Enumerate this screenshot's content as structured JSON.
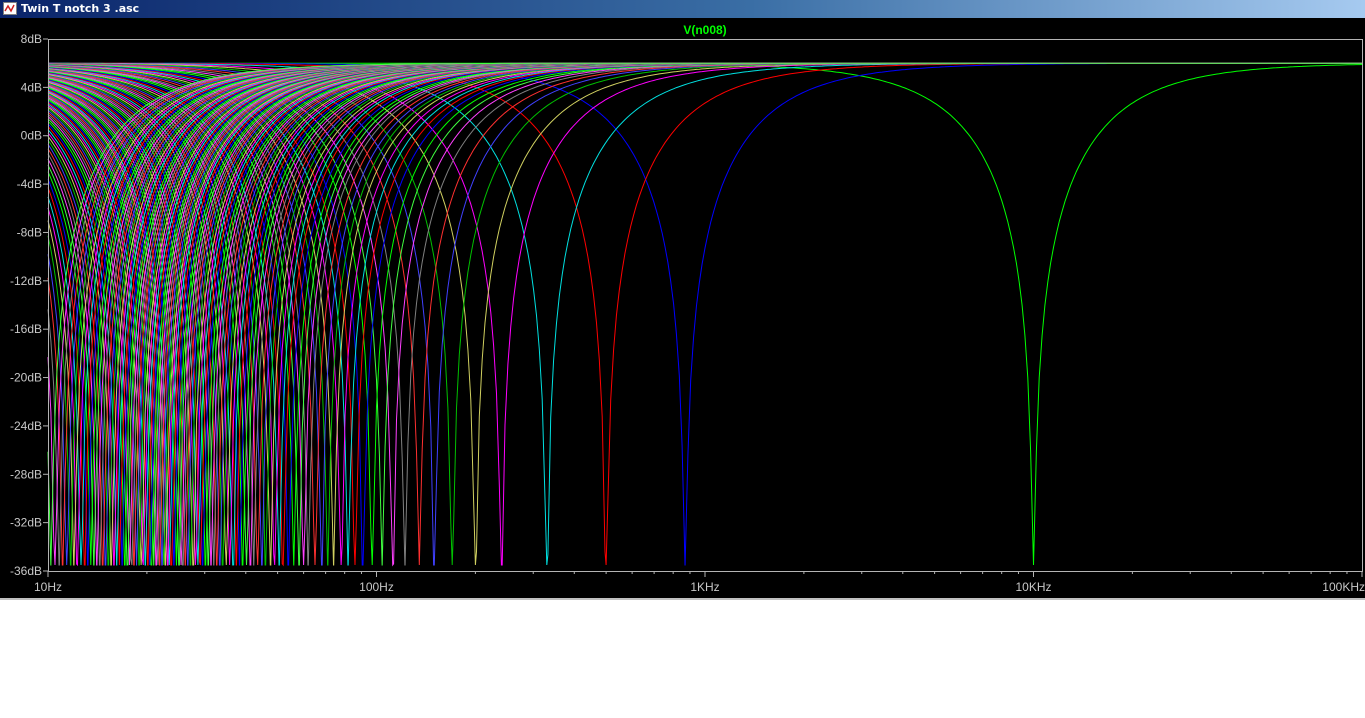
{
  "window": {
    "title": "Twin T notch 3 .asc"
  },
  "chart_data": {
    "type": "line",
    "title": "V(n008)",
    "xlabel": "",
    "ylabel": "",
    "x_scale": "log",
    "xlim": [
      10,
      100000
    ],
    "ylim": [
      -36,
      8
    ],
    "grid": false,
    "y_ticks": [
      "8dB",
      "4dB",
      "0dB",
      "-4dB",
      "-8dB",
      "-12dB",
      "-16dB",
      "-20dB",
      "-24dB",
      "-28dB",
      "-32dB",
      "-36dB"
    ],
    "y_tick_values": [
      8,
      4,
      0,
      -4,
      -8,
      -12,
      -16,
      -20,
      -24,
      -28,
      -32,
      -36
    ],
    "x_ticks": [
      "10Hz",
      "100Hz",
      "1KHz",
      "10KHz",
      "100KHz"
    ],
    "x_tick_values": [
      10,
      100,
      1000,
      10000,
      100000
    ],
    "passband_gain_db": 6,
    "notch_depth_db": -35.5,
    "series_colors": [
      "#00ff00",
      "#0000ff",
      "#ff0000",
      "#00e0e0",
      "#ff00ff",
      "#d0d060",
      "#00c000",
      "#4040ff",
      "#ff3030",
      "#808080",
      "#ff40ff",
      "#40ff40"
    ],
    "notch_frequencies_hz": [
      10000,
      870,
      500,
      330,
      240,
      200,
      170,
      150,
      135,
      122,
      112,
      104,
      97,
      91,
      86,
      82,
      78,
      74,
      71,
      68,
      65,
      62,
      60,
      58,
      56,
      54,
      52,
      50.5,
      49,
      47.5,
      46,
      44.7,
      43.5,
      42.3,
      41.2,
      40.2,
      39.2,
      38.3,
      37.4,
      36.5,
      35.7,
      34.9,
      34.1,
      33.4,
      32.7,
      32,
      31.4,
      30.8,
      30.2,
      29.6,
      29.1,
      28.6,
      28.1,
      27.6,
      27.1,
      26.6,
      26.2,
      25.8,
      25.4,
      25,
      24.6,
      24.2,
      23.8,
      23.4,
      23.1,
      22.8,
      22.5,
      22.2,
      21.9,
      21.6,
      21.3,
      21,
      20.7,
      20.4,
      20.1,
      19.8,
      19.5,
      19.2,
      18.9,
      18.6,
      18.3,
      18,
      17.7,
      17.4,
      17.1,
      16.8,
      16.5,
      16.2,
      15.9,
      15.6,
      15.3,
      15,
      14.7,
      14.4,
      14.1,
      13.8,
      13.5,
      13.2,
      12.9,
      12.6,
      12.3,
      12,
      11.7,
      11.4,
      11.1,
      10.8,
      10.5,
      10.2
    ]
  }
}
